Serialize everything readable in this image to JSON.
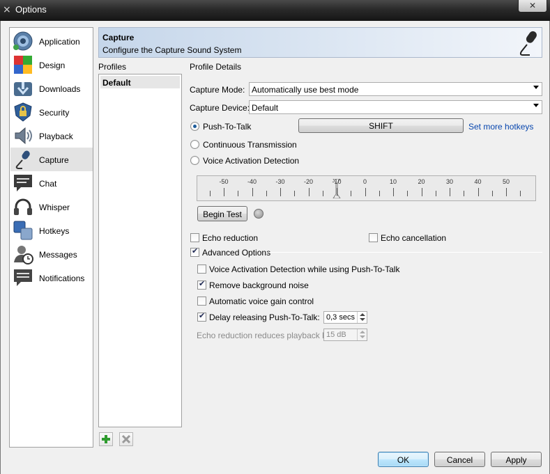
{
  "window": {
    "title": "Options",
    "close_glyph": "✕"
  },
  "categories": [
    {
      "label": "Application",
      "icon": "application-icon"
    },
    {
      "label": "Design",
      "icon": "design-icon"
    },
    {
      "label": "Downloads",
      "icon": "downloads-icon"
    },
    {
      "label": "Security",
      "icon": "security-icon"
    },
    {
      "label": "Playback",
      "icon": "playback-icon"
    },
    {
      "label": "Capture",
      "icon": "microphone-icon",
      "selected": true
    },
    {
      "label": "Chat",
      "icon": "chat-icon"
    },
    {
      "label": "Whisper",
      "icon": "headset-icon"
    },
    {
      "label": "Hotkeys",
      "icon": "hotkeys-icon"
    },
    {
      "label": "Messages",
      "icon": "messages-icon"
    },
    {
      "label": "Notifications",
      "icon": "notifications-icon"
    }
  ],
  "banner": {
    "title": "Capture",
    "subtitle": "Configure the Capture Sound System",
    "icon": "microphone-icon"
  },
  "profiles": {
    "label": "Profiles",
    "items": [
      "Default"
    ],
    "add_icon": "plus-icon",
    "remove_icon": "remove-icon"
  },
  "details": {
    "label": "Profile Details",
    "capture_mode": {
      "label": "Capture Mode:",
      "value": "Automatically use best mode"
    },
    "capture_device": {
      "label": "Capture Device:",
      "value": "Default"
    },
    "push_to_talk": {
      "label": "Push-To-Talk",
      "checked": true,
      "hotkey": "SHIFT",
      "link": "Set more hotkeys"
    },
    "continuous": {
      "label": "Continuous Transmission",
      "checked": false
    },
    "vad": {
      "label": "Voice Activation Detection",
      "checked": false
    },
    "slider": {
      "tick_labels": [
        "-50",
        "-40",
        "-30",
        "-20",
        "-10",
        "0",
        "10",
        "20",
        "30",
        "40",
        "50"
      ],
      "value": -10
    },
    "begin_test": "Begin Test",
    "echo_reduction": {
      "label": "Echo reduction",
      "checked": false
    },
    "echo_cancellation": {
      "label": "Echo cancellation",
      "checked": false
    },
    "advanced": {
      "label": "Advanced Options",
      "checked": true
    },
    "vad_while_ptt": {
      "label": "Voice Activation Detection while using Push-To-Talk",
      "checked": false
    },
    "remove_noise": {
      "label": "Remove background noise",
      "checked": true
    },
    "agc": {
      "label": "Automatic voice gain control",
      "checked": false
    },
    "delay_release": {
      "label": "Delay releasing Push-To-Talk:",
      "checked": true,
      "value": "0,3 secs"
    },
    "echo_playback": {
      "label": "Echo reduction reduces playback by:",
      "value": "15 dB",
      "disabled": true
    }
  },
  "buttons": {
    "ok": "OK",
    "cancel": "Cancel",
    "apply": "Apply"
  }
}
